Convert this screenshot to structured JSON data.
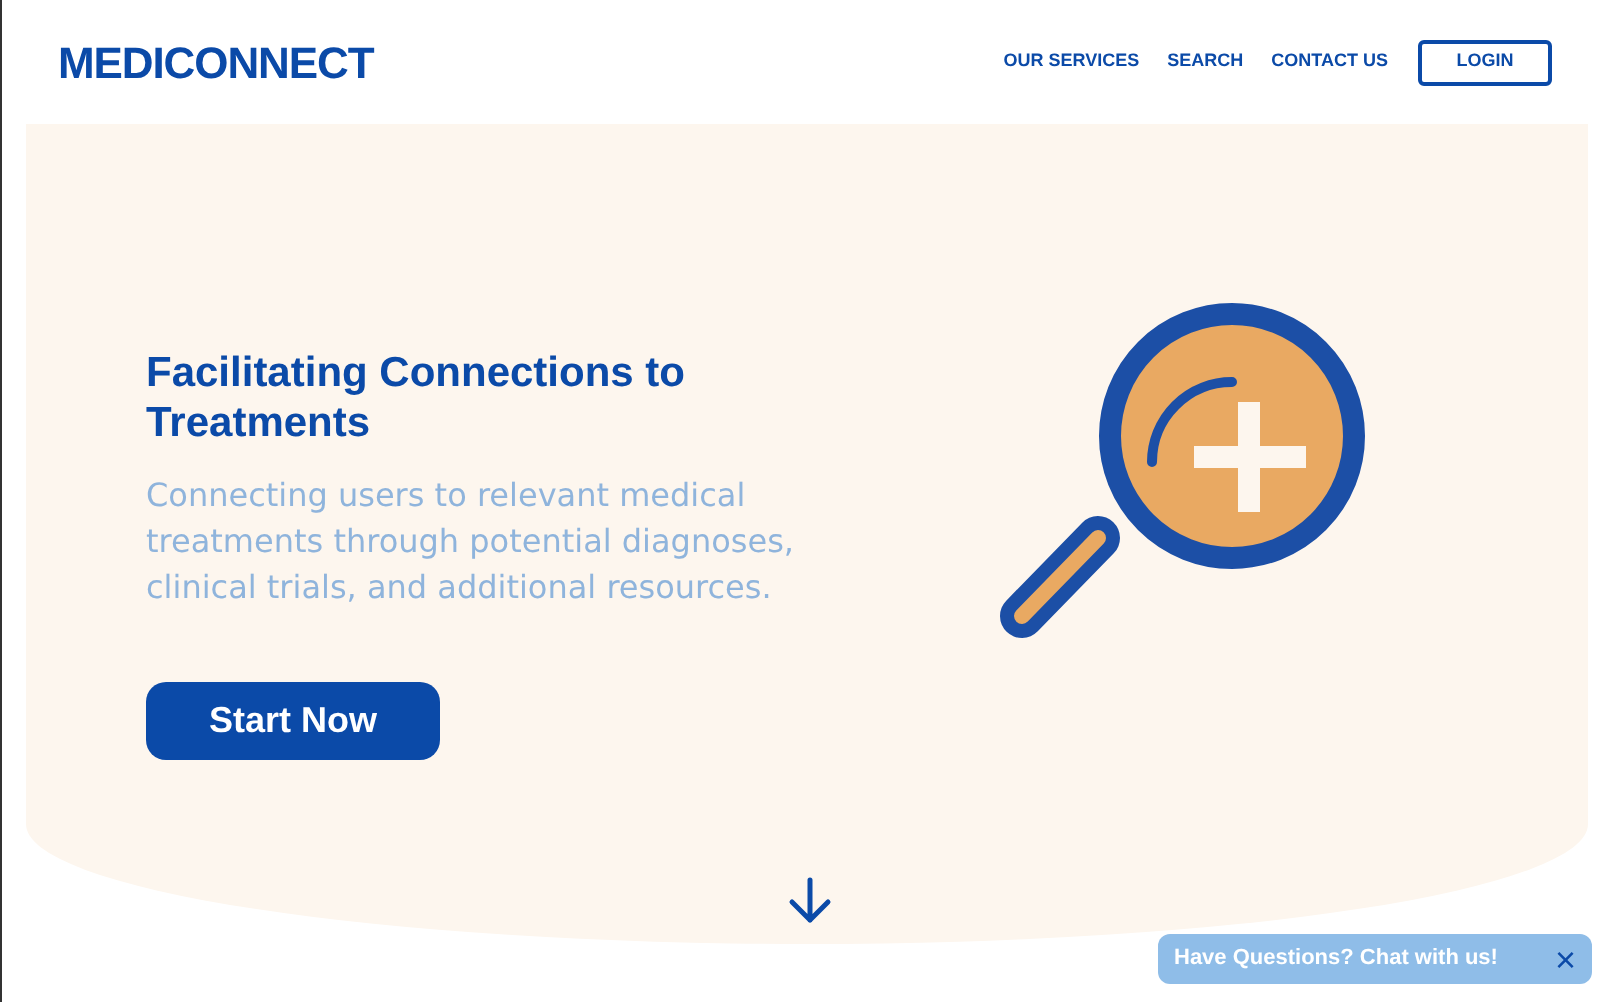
{
  "header": {
    "logo": "MEDICONNECT",
    "nav": [
      {
        "label": "OUR SERVICES"
      },
      {
        "label": "SEARCH"
      },
      {
        "label": "CONTACT US"
      }
    ],
    "login": "LOGIN"
  },
  "hero": {
    "title": "Facilitating Connections to Treatments",
    "subtitle": "Connecting users to relevant medical treatments through potential diagnoses, clinical trials, and additional resources.",
    "cta": "Start Now"
  },
  "chat": {
    "label": "Have Questions? Chat with us!",
    "close": "×"
  }
}
